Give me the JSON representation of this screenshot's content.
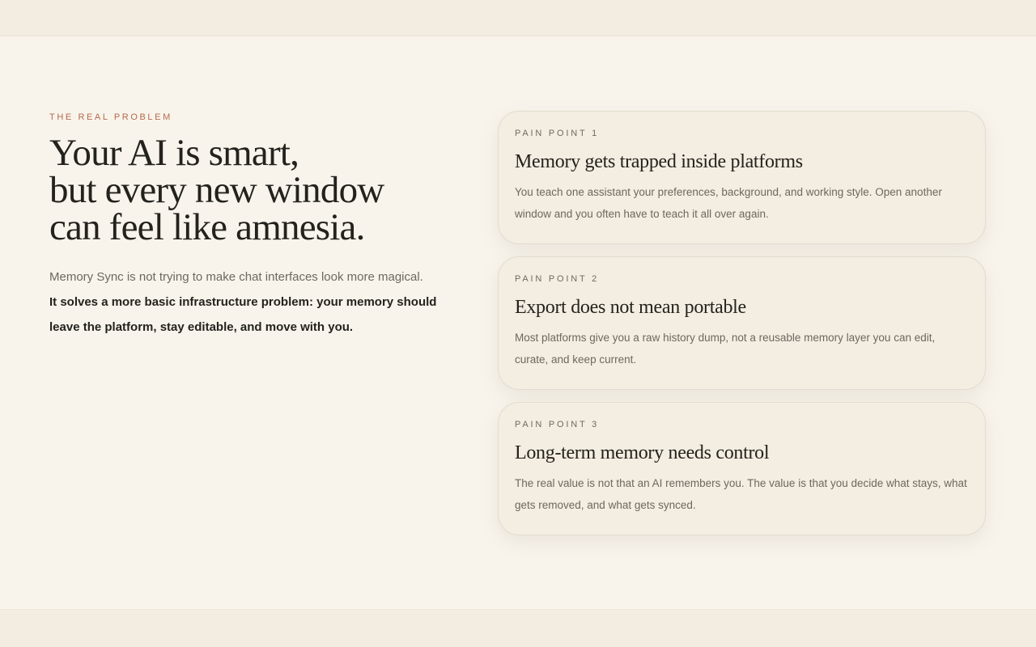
{
  "intro": {
    "eyebrow": "THE REAL PROBLEM",
    "headline_lines": [
      "Your AI is smart,",
      "but every new window",
      "can feel like amnesia."
    ],
    "lede": "Memory Sync is not trying to make chat interfaces look more magical.",
    "lede_strong": "It solves a more basic infrastructure problem: your memory should leave the platform, stay editable, and move with you."
  },
  "pain_points": [
    {
      "label": "PAIN POINT 1",
      "title": "Memory gets trapped inside platforms",
      "body": "You teach one assistant your preferences, background, and working style. Open another window and you often have to teach it all over again."
    },
    {
      "label": "PAIN POINT 2",
      "title": "Export does not mean portable",
      "body": "Most platforms give you a raw history dump, not a reusable memory layer you can edit, curate, and keep current."
    },
    {
      "label": "PAIN POINT 3",
      "title": "Long-term memory needs control",
      "body": "The real value is not that an AI remembers you. The value is that you decide what stays, what gets removed, and what gets synced."
    }
  ],
  "colors": {
    "background": "#f8f4ec",
    "card": "#f3ede2",
    "accent": "#b5694a",
    "text": "#24221c",
    "muted": "#6d685f"
  }
}
